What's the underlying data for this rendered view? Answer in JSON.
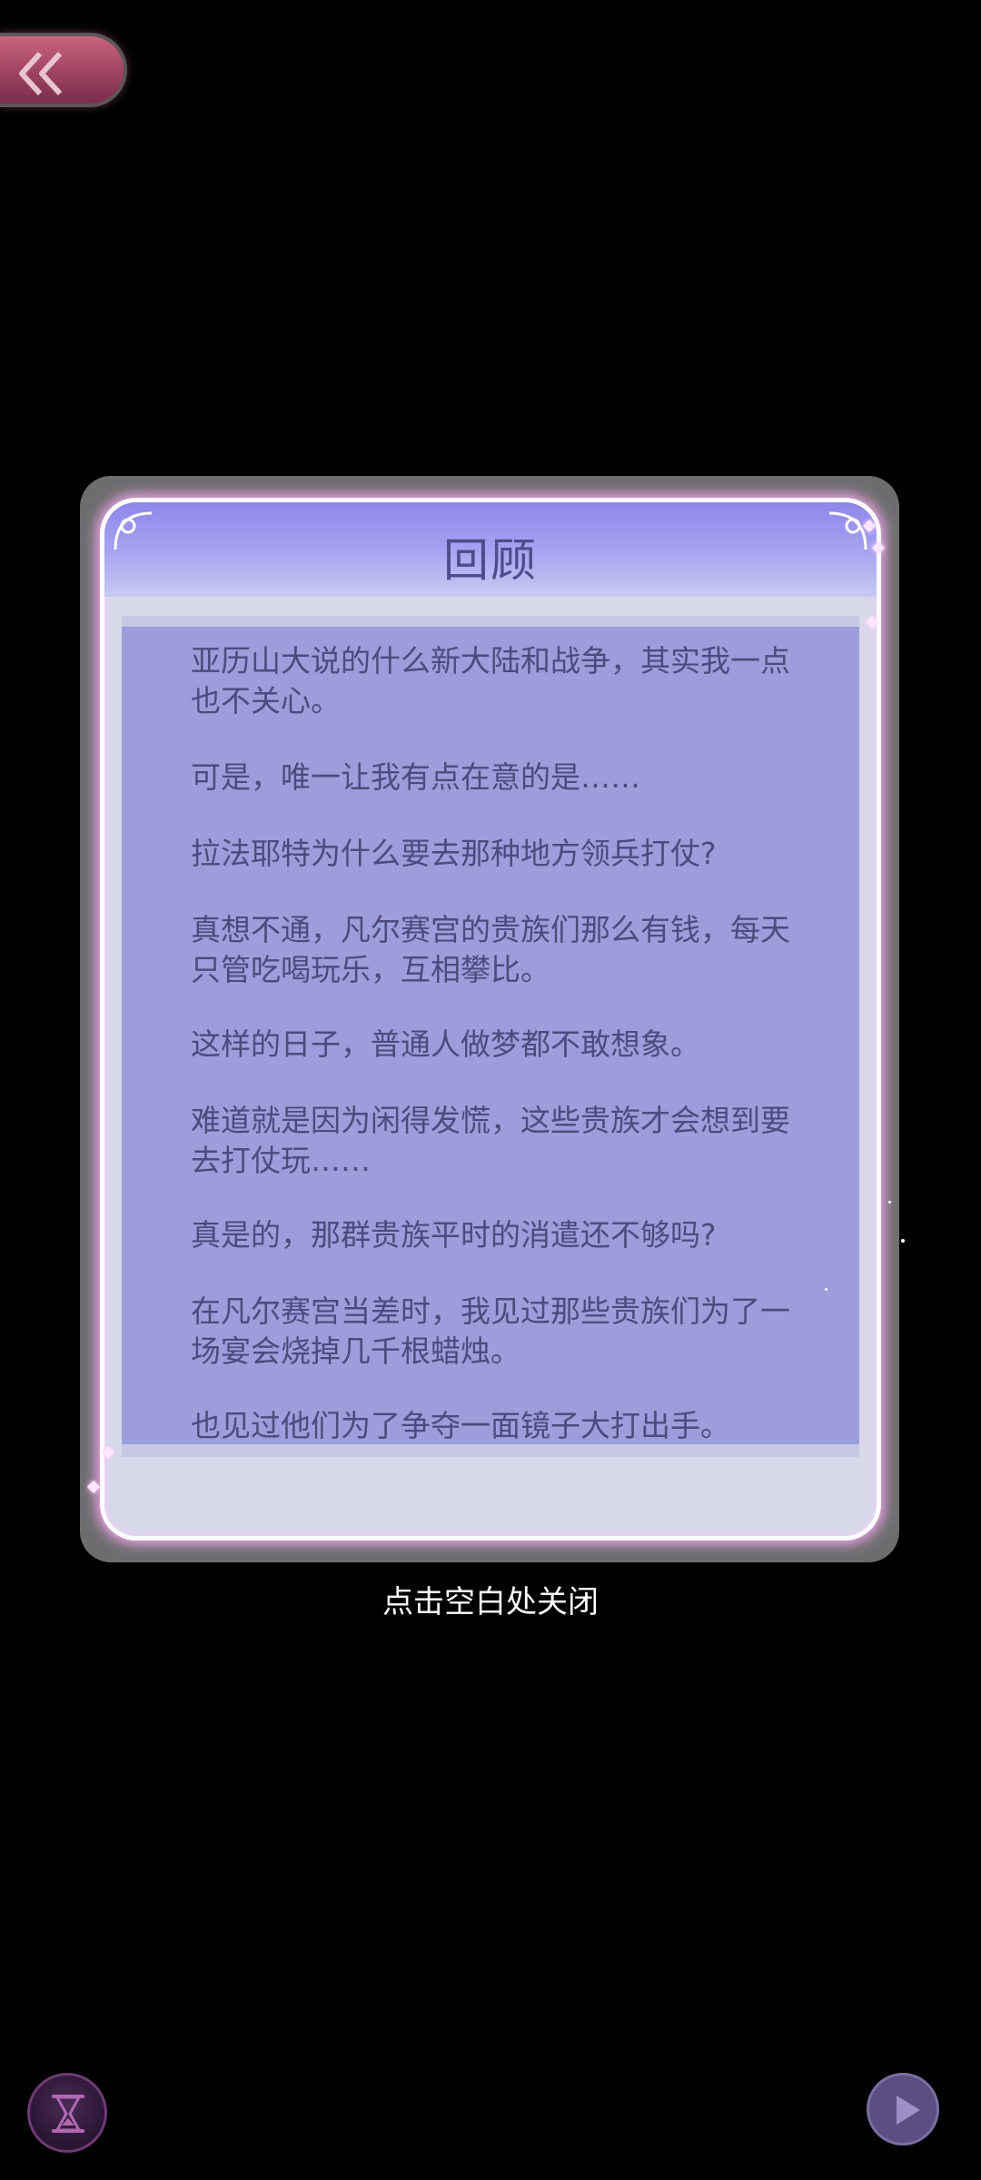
{
  "dialog": {
    "title": "回顾",
    "paragraphs": [
      "亚历山大说的什么新大陆和战争，其实我一点也不关心。",
      "可是，唯一让我有点在意的是……",
      "拉法耶特为什么要去那种地方领兵打仗?",
      "真想不通，凡尔赛宫的贵族们那么有钱，每天只管吃喝玩乐，互相攀比。",
      "这样的日子，普通人做梦都不敢想象。",
      "难道就是因为闲得发慌，这些贵族才会想到要去打仗玩……",
      "真是的，那群贵族平时的消遣还不够吗?",
      "在凡尔赛宫当差时，我见过那些贵族们为了一场宴会烧掉几千根蜡烛。",
      "也见过他们为了争夺一面镜子大打出手。"
    ]
  },
  "close_hint": "点击空白处关闭",
  "icons": {
    "back": "double-chevron-left-icon",
    "hourglass": "hourglass-icon",
    "play": "play-icon"
  },
  "colors": {
    "header": "#9a97ee",
    "content_bg": "#9b9edb",
    "text": "#4d4b7e",
    "frame_glow": "#f0a6ea",
    "back_button": "#9e4262"
  }
}
